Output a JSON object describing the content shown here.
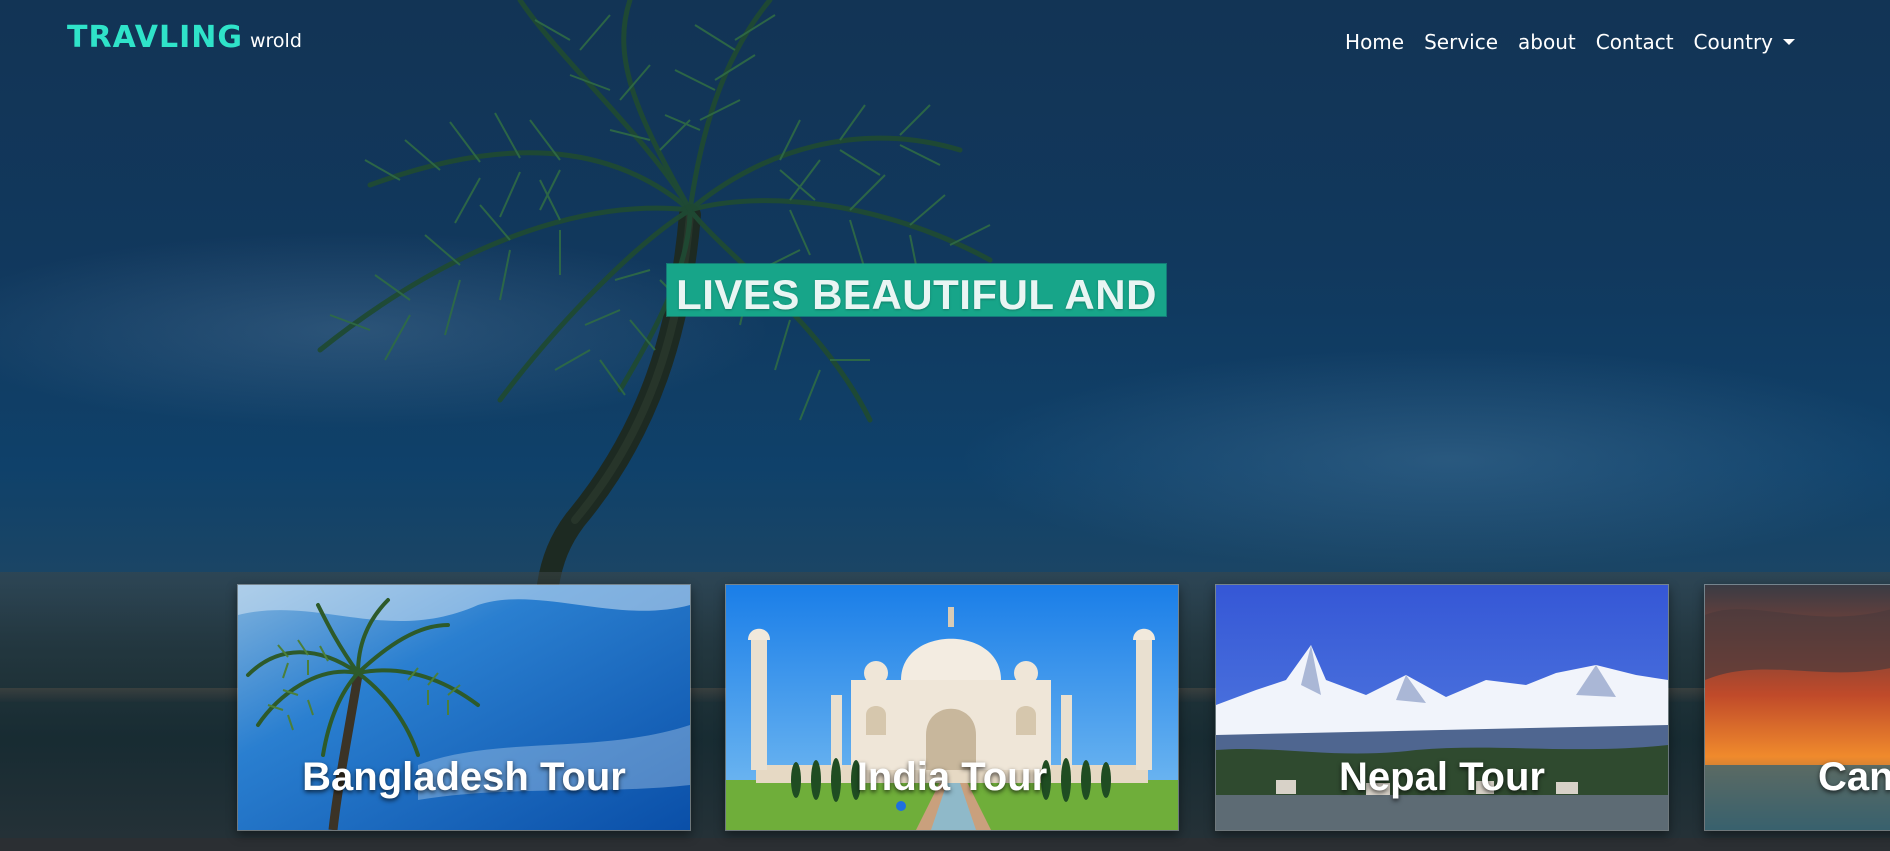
{
  "brand": {
    "name": "TRAVLING",
    "tagline": "wrold"
  },
  "nav": {
    "items": [
      {
        "label": "Home"
      },
      {
        "label": "Service"
      },
      {
        "label": "about"
      },
      {
        "label": "Contact"
      },
      {
        "label": "Country"
      }
    ]
  },
  "hero": {
    "headline": "LIVES BEAUTIFUL AND"
  },
  "tours": [
    {
      "title": "Bangladesh Tour"
    },
    {
      "title": "India Tour"
    },
    {
      "title": "Nepal Tour"
    },
    {
      "title": "Can"
    }
  ],
  "colors": {
    "brand_accent": "#2fe3c9",
    "headline_bg": "#17a589",
    "slider_dot": "#1e6fe0"
  },
  "icons": {
    "country_dropdown": "caret-down-icon"
  }
}
